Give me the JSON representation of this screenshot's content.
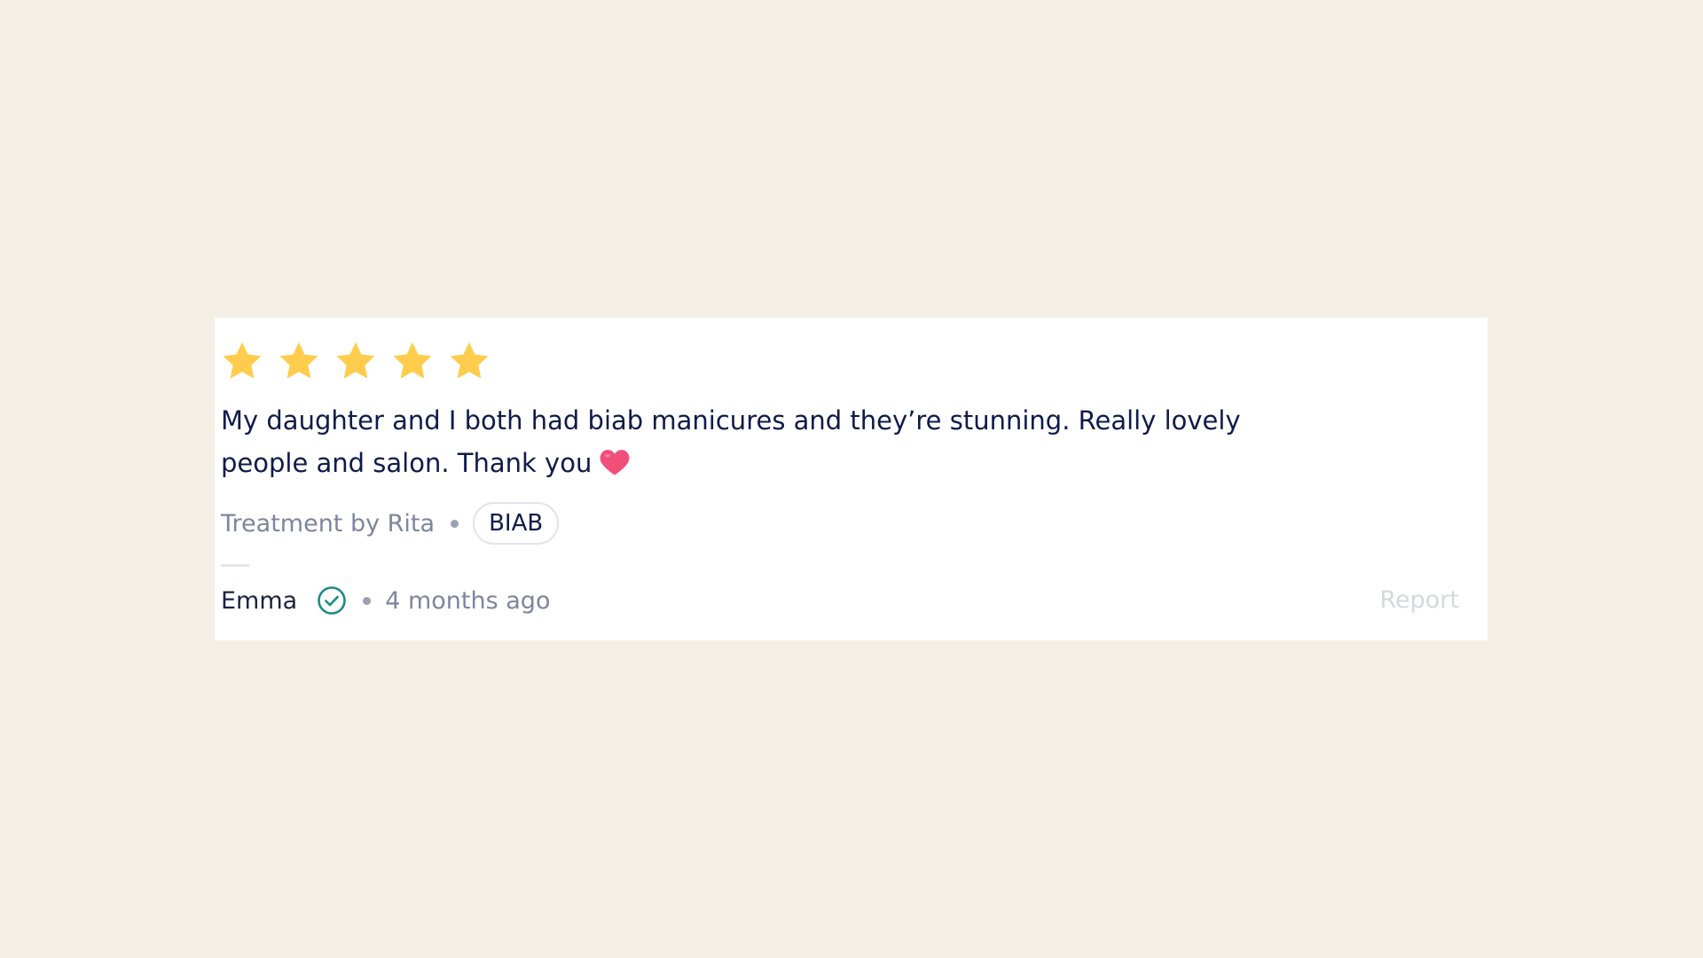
{
  "review": {
    "rating": 5,
    "rating_max": 5,
    "text": "My daughter and I both had biab manicures and they’re stunning. Really lovely people and salon. Thank you",
    "emoji": "heart-emoji",
    "treatment_by": "Treatment by Rita",
    "service_tag": "BIAB",
    "author": "Emma",
    "verified_icon": "verified-check-icon",
    "time_ago": "4 months ago",
    "report_label": "Report"
  },
  "colors": {
    "background": "#f4f0e6",
    "card": "#ffffff",
    "star": "#ffcc4d",
    "text_primary": "#0f1b4a",
    "text_secondary": "#7e859e",
    "verified": "#1a8c86",
    "heart": "#f24e7a",
    "report": "#d6d8e0"
  }
}
